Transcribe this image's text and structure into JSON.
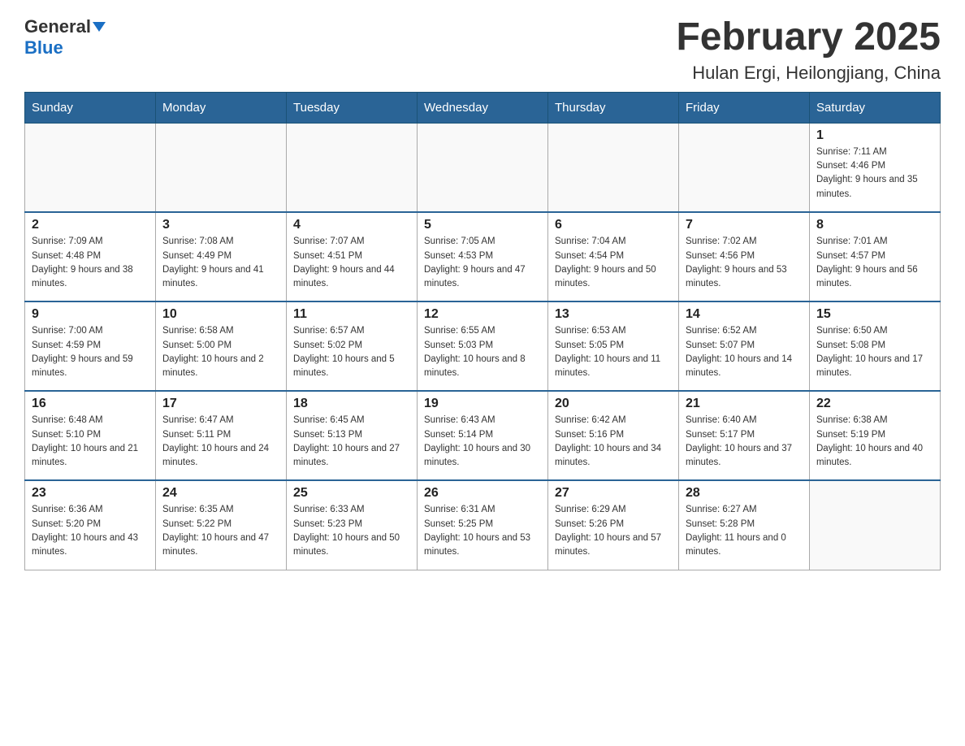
{
  "header": {
    "logo_general": "General",
    "logo_blue": "Blue",
    "title": "February 2025",
    "subtitle": "Hulan Ergi, Heilongjiang, China"
  },
  "weekdays": [
    "Sunday",
    "Monday",
    "Tuesday",
    "Wednesday",
    "Thursday",
    "Friday",
    "Saturday"
  ],
  "weeks": [
    {
      "days": [
        {
          "num": "",
          "info": ""
        },
        {
          "num": "",
          "info": ""
        },
        {
          "num": "",
          "info": ""
        },
        {
          "num": "",
          "info": ""
        },
        {
          "num": "",
          "info": ""
        },
        {
          "num": "",
          "info": ""
        },
        {
          "num": "1",
          "info": "Sunrise: 7:11 AM\nSunset: 4:46 PM\nDaylight: 9 hours and 35 minutes."
        }
      ]
    },
    {
      "days": [
        {
          "num": "2",
          "info": "Sunrise: 7:09 AM\nSunset: 4:48 PM\nDaylight: 9 hours and 38 minutes."
        },
        {
          "num": "3",
          "info": "Sunrise: 7:08 AM\nSunset: 4:49 PM\nDaylight: 9 hours and 41 minutes."
        },
        {
          "num": "4",
          "info": "Sunrise: 7:07 AM\nSunset: 4:51 PM\nDaylight: 9 hours and 44 minutes."
        },
        {
          "num": "5",
          "info": "Sunrise: 7:05 AM\nSunset: 4:53 PM\nDaylight: 9 hours and 47 minutes."
        },
        {
          "num": "6",
          "info": "Sunrise: 7:04 AM\nSunset: 4:54 PM\nDaylight: 9 hours and 50 minutes."
        },
        {
          "num": "7",
          "info": "Sunrise: 7:02 AM\nSunset: 4:56 PM\nDaylight: 9 hours and 53 minutes."
        },
        {
          "num": "8",
          "info": "Sunrise: 7:01 AM\nSunset: 4:57 PM\nDaylight: 9 hours and 56 minutes."
        }
      ]
    },
    {
      "days": [
        {
          "num": "9",
          "info": "Sunrise: 7:00 AM\nSunset: 4:59 PM\nDaylight: 9 hours and 59 minutes."
        },
        {
          "num": "10",
          "info": "Sunrise: 6:58 AM\nSunset: 5:00 PM\nDaylight: 10 hours and 2 minutes."
        },
        {
          "num": "11",
          "info": "Sunrise: 6:57 AM\nSunset: 5:02 PM\nDaylight: 10 hours and 5 minutes."
        },
        {
          "num": "12",
          "info": "Sunrise: 6:55 AM\nSunset: 5:03 PM\nDaylight: 10 hours and 8 minutes."
        },
        {
          "num": "13",
          "info": "Sunrise: 6:53 AM\nSunset: 5:05 PM\nDaylight: 10 hours and 11 minutes."
        },
        {
          "num": "14",
          "info": "Sunrise: 6:52 AM\nSunset: 5:07 PM\nDaylight: 10 hours and 14 minutes."
        },
        {
          "num": "15",
          "info": "Sunrise: 6:50 AM\nSunset: 5:08 PM\nDaylight: 10 hours and 17 minutes."
        }
      ]
    },
    {
      "days": [
        {
          "num": "16",
          "info": "Sunrise: 6:48 AM\nSunset: 5:10 PM\nDaylight: 10 hours and 21 minutes."
        },
        {
          "num": "17",
          "info": "Sunrise: 6:47 AM\nSunset: 5:11 PM\nDaylight: 10 hours and 24 minutes."
        },
        {
          "num": "18",
          "info": "Sunrise: 6:45 AM\nSunset: 5:13 PM\nDaylight: 10 hours and 27 minutes."
        },
        {
          "num": "19",
          "info": "Sunrise: 6:43 AM\nSunset: 5:14 PM\nDaylight: 10 hours and 30 minutes."
        },
        {
          "num": "20",
          "info": "Sunrise: 6:42 AM\nSunset: 5:16 PM\nDaylight: 10 hours and 34 minutes."
        },
        {
          "num": "21",
          "info": "Sunrise: 6:40 AM\nSunset: 5:17 PM\nDaylight: 10 hours and 37 minutes."
        },
        {
          "num": "22",
          "info": "Sunrise: 6:38 AM\nSunset: 5:19 PM\nDaylight: 10 hours and 40 minutes."
        }
      ]
    },
    {
      "days": [
        {
          "num": "23",
          "info": "Sunrise: 6:36 AM\nSunset: 5:20 PM\nDaylight: 10 hours and 43 minutes."
        },
        {
          "num": "24",
          "info": "Sunrise: 6:35 AM\nSunset: 5:22 PM\nDaylight: 10 hours and 47 minutes."
        },
        {
          "num": "25",
          "info": "Sunrise: 6:33 AM\nSunset: 5:23 PM\nDaylight: 10 hours and 50 minutes."
        },
        {
          "num": "26",
          "info": "Sunrise: 6:31 AM\nSunset: 5:25 PM\nDaylight: 10 hours and 53 minutes."
        },
        {
          "num": "27",
          "info": "Sunrise: 6:29 AM\nSunset: 5:26 PM\nDaylight: 10 hours and 57 minutes."
        },
        {
          "num": "28",
          "info": "Sunrise: 6:27 AM\nSunset: 5:28 PM\nDaylight: 11 hours and 0 minutes."
        },
        {
          "num": "",
          "info": ""
        }
      ]
    }
  ]
}
